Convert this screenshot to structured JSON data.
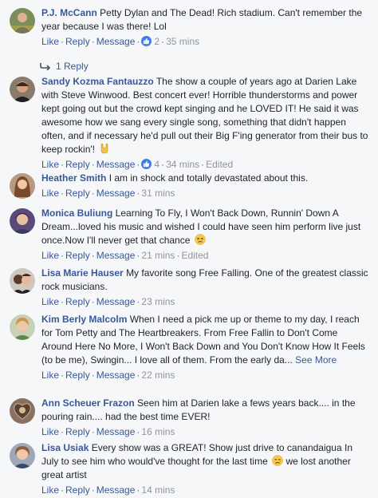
{
  "actions": {
    "like": "Like",
    "reply": "Reply",
    "message": "Message",
    "separator": "·"
  },
  "comments": [
    {
      "author": "P.J. McCann",
      "text": "Petty Dylan and The Dead! Rich stadium. Can't remember the year because I was there! Lol",
      "likes": "2",
      "time": "35 mins",
      "edited": "",
      "see_more": "",
      "replies_label": "1 Reply"
    },
    {
      "author": "Sandy Kozma Fantauzzo",
      "text": "The show a couple of years ago at Darien Lake with Steve Winwood. Best concert ever! Horrible thunderstorms and power kept going out but the crowd kept singing and he LOVED IT! He said it was awesome how we sang every single song, something that didn't happen often, and if necessary he'd pull out their Big F'ing generator from their bus to keep rockin'!",
      "likes": "4",
      "time": "34 mins",
      "edited": "Edited",
      "see_more": ""
    },
    {
      "author": "Heather Smith",
      "text": "I am in shock and totally devastated about this.",
      "likes": "",
      "time": "31 mins",
      "edited": "",
      "see_more": ""
    },
    {
      "author": "Monica Buliung",
      "text": "Learning To Fly, I Won't Back Down, Runnin' Down A Dream...loved his music and wished I could have seen him perform live just once.Now I'll never get that chance",
      "likes": "",
      "time": "21 mins",
      "edited": "Edited",
      "see_more": ""
    },
    {
      "author": "Lisa Marie Hauser",
      "text": "My favorite song Free Falling. One of the greatest classic rock musicians.",
      "likes": "",
      "time": "23 mins",
      "edited": "",
      "see_more": ""
    },
    {
      "author": "Kim Berly Malcolm",
      "text": "When I need a pick me up or theme to my day, I reach for Tom Petty and The Heartbreakers. From Free Fallin to Don't Come Around Here No More, I Won't Back Down and You Don't Know How It Feels (to be me), Swingin... I love all of them. From the early da...",
      "likes": "",
      "time": "22 mins",
      "edited": "",
      "see_more": "See More"
    },
    {
      "author": "Ann Scheuer Frazon",
      "text": "Seen him at Darien lake a fews years back.... in the pouring rain.... had the best time EVER!",
      "likes": "",
      "time": "16 mins",
      "edited": "",
      "see_more": ""
    },
    {
      "author": "Lisa Usiak",
      "text": "Every show was a GREAT! Show just drive to canandaigua In July to see him who would've thought for the last time",
      "text_after_emoji": "we lost another great artist",
      "likes": "",
      "time": "14 mins",
      "edited": "",
      "see_more": ""
    }
  ]
}
